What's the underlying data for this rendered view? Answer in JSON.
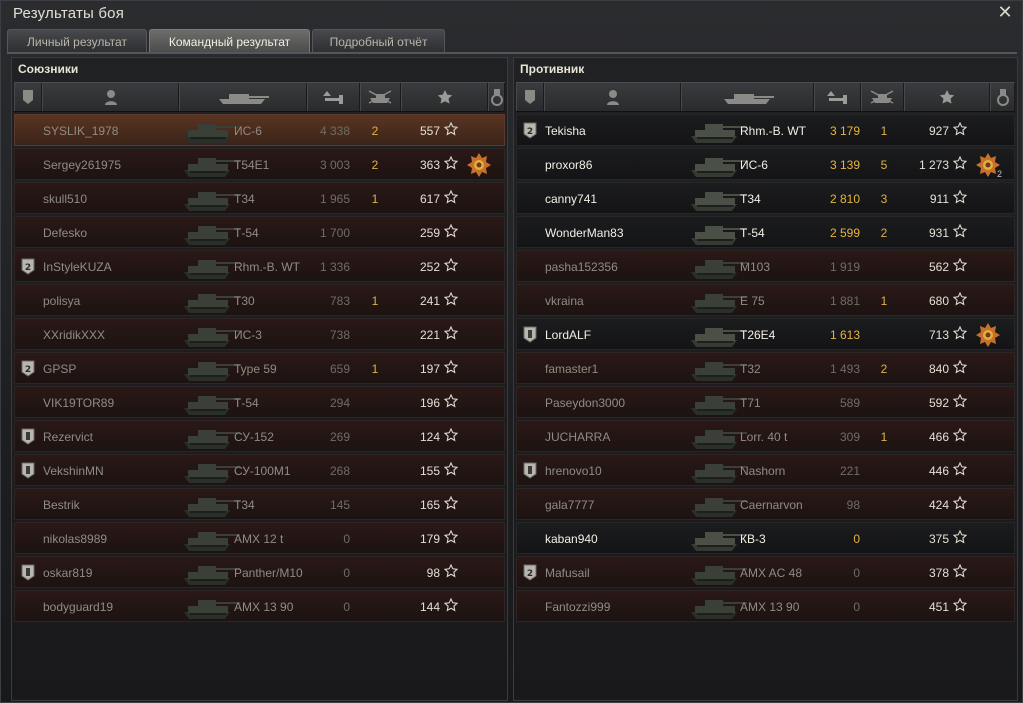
{
  "window": {
    "title": "Результаты боя",
    "close_label": "✕"
  },
  "tabs": [
    {
      "label": "Личный результат",
      "active": false
    },
    {
      "label": "Командный результат",
      "active": true
    },
    {
      "label": "Подробный отчёт",
      "active": false
    }
  ],
  "columns": [
    "squad",
    "player",
    "vehicle",
    "damage",
    "kills",
    "xp",
    "medals"
  ],
  "allies": {
    "title": "Союзники",
    "rows": [
      {
        "name": "SYSLIK_1978",
        "vehicle": "ИС-6",
        "damage": "4 338",
        "kills": "2",
        "xp": "557",
        "badge": "",
        "medal": "",
        "alive": false,
        "self": true
      },
      {
        "name": "Sergey261975",
        "vehicle": "T54E1",
        "damage": "3 003",
        "kills": "2",
        "xp": "363",
        "badge": "",
        "medal": "medal-icon",
        "alive": false,
        "self": false
      },
      {
        "name": "skull510",
        "vehicle": "T34",
        "damage": "1 965",
        "kills": "1",
        "xp": "617",
        "badge": "",
        "medal": "",
        "alive": false,
        "self": false
      },
      {
        "name": "Defesko",
        "vehicle": "Т-54",
        "damage": "1 700",
        "kills": "",
        "xp": "259",
        "badge": "",
        "medal": "",
        "alive": false,
        "self": false
      },
      {
        "name": "InStyleKUZA",
        "vehicle": "Rhm.-B. WT",
        "damage": "1 336",
        "kills": "",
        "xp": "252",
        "badge": "2",
        "medal": "",
        "alive": false,
        "self": false
      },
      {
        "name": "polisya",
        "vehicle": "T30",
        "damage": "783",
        "kills": "1",
        "xp": "241",
        "badge": "",
        "medal": "",
        "alive": false,
        "self": false
      },
      {
        "name": "XXridikXXX",
        "vehicle": "ИС-3",
        "damage": "738",
        "kills": "",
        "xp": "221",
        "badge": "",
        "medal": "",
        "alive": false,
        "self": false
      },
      {
        "name": "GPSP",
        "vehicle": "Type 59",
        "damage": "659",
        "kills": "1",
        "xp": "197",
        "badge": "2",
        "medal": "",
        "alive": false,
        "self": false
      },
      {
        "name": "VIK19TOR89",
        "vehicle": "Т-54",
        "damage": "294",
        "kills": "",
        "xp": "196",
        "badge": "",
        "medal": "",
        "alive": false,
        "self": false
      },
      {
        "name": "Rezervict",
        "vehicle": "СУ-152",
        "damage": "269",
        "kills": "",
        "xp": "124",
        "badge": "1",
        "medal": "",
        "alive": false,
        "self": false
      },
      {
        "name": "VekshinMN",
        "vehicle": "СУ-100М1",
        "damage": "268",
        "kills": "",
        "xp": "155",
        "badge": "1",
        "medal": "",
        "alive": false,
        "self": false
      },
      {
        "name": "Bestrik",
        "vehicle": "T34",
        "damage": "145",
        "kills": "",
        "xp": "165",
        "badge": "",
        "medal": "",
        "alive": false,
        "self": false
      },
      {
        "name": "nikolas8989",
        "vehicle": "AMX 12 t",
        "damage": "0",
        "kills": "",
        "xp": "179",
        "badge": "",
        "medal": "",
        "alive": false,
        "self": false
      },
      {
        "name": "oskar819",
        "vehicle": "Panther/M10",
        "damage": "0",
        "kills": "",
        "xp": "98",
        "badge": "1",
        "medal": "",
        "alive": false,
        "self": false
      },
      {
        "name": "bodyguard19",
        "vehicle": "AMX 13 90",
        "damage": "0",
        "kills": "",
        "xp": "144",
        "badge": "",
        "medal": "",
        "alive": false,
        "self": false
      }
    ]
  },
  "enemies": {
    "title": "Противник",
    "rows": [
      {
        "name": "Tekisha",
        "vehicle": "Rhm.-B. WT",
        "damage": "3 179",
        "kills": "1",
        "xp": "927",
        "badge": "2",
        "medal": "",
        "alive": true,
        "self": false
      },
      {
        "name": "proxor86",
        "vehicle": "ИС-6",
        "damage": "3 139",
        "kills": "5",
        "xp": "1 273",
        "badge": "",
        "medal": "medal-icon",
        "medal_count": "2",
        "alive": true,
        "self": false
      },
      {
        "name": "canny741",
        "vehicle": "T34",
        "damage": "2 810",
        "kills": "3",
        "xp": "911",
        "badge": "",
        "medal": "",
        "alive": true,
        "self": false
      },
      {
        "name": "WonderMan83",
        "vehicle": "Т-54",
        "damage": "2 599",
        "kills": "2",
        "xp": "931",
        "badge": "",
        "medal": "",
        "alive": true,
        "self": false
      },
      {
        "name": "pasha152356",
        "vehicle": "M103",
        "damage": "1 919",
        "kills": "",
        "xp": "562",
        "badge": "",
        "medal": "",
        "alive": false,
        "self": false
      },
      {
        "name": "vkraina",
        "vehicle": "E 75",
        "damage": "1 881",
        "kills": "1",
        "xp": "680",
        "badge": "",
        "medal": "",
        "alive": false,
        "self": false
      },
      {
        "name": "LordALF",
        "vehicle": "T26E4",
        "damage": "1 613",
        "kills": "",
        "xp": "713",
        "badge": "1",
        "medal": "medal-icon",
        "alive": true,
        "self": false
      },
      {
        "name": "famaster1",
        "vehicle": "T32",
        "damage": "1 493",
        "kills": "2",
        "xp": "840",
        "badge": "",
        "medal": "",
        "alive": false,
        "self": false
      },
      {
        "name": "Paseydon3000",
        "vehicle": "T71",
        "damage": "589",
        "kills": "",
        "xp": "592",
        "badge": "",
        "medal": "",
        "alive": false,
        "self": false
      },
      {
        "name": "JUCHARRA",
        "vehicle": "Lorr. 40 t",
        "damage": "309",
        "kills": "1",
        "xp": "466",
        "badge": "",
        "medal": "",
        "alive": false,
        "self": false
      },
      {
        "name": "hrenovo10",
        "vehicle": "Nashorn",
        "damage": "221",
        "kills": "",
        "xp": "446",
        "badge": "1",
        "medal": "",
        "alive": false,
        "self": false
      },
      {
        "name": "gala7777",
        "vehicle": "Caernarvon",
        "damage": "98",
        "kills": "",
        "xp": "424",
        "badge": "",
        "medal": "",
        "alive": false,
        "self": false
      },
      {
        "name": "kaban940",
        "vehicle": "КВ-3",
        "damage": "0",
        "kills": "",
        "xp": "375",
        "badge": "",
        "medal": "",
        "alive": true,
        "self": false
      },
      {
        "name": "Mafusail",
        "vehicle": "AMX AC 48",
        "damage": "0",
        "kills": "",
        "xp": "378",
        "badge": "2",
        "medal": "",
        "alive": false,
        "self": false
      },
      {
        "name": "Fantozzi999",
        "vehicle": "AMX 13 90",
        "damage": "0",
        "kills": "",
        "xp": "451",
        "badge": "",
        "medal": "",
        "alive": false,
        "self": false
      }
    ]
  }
}
